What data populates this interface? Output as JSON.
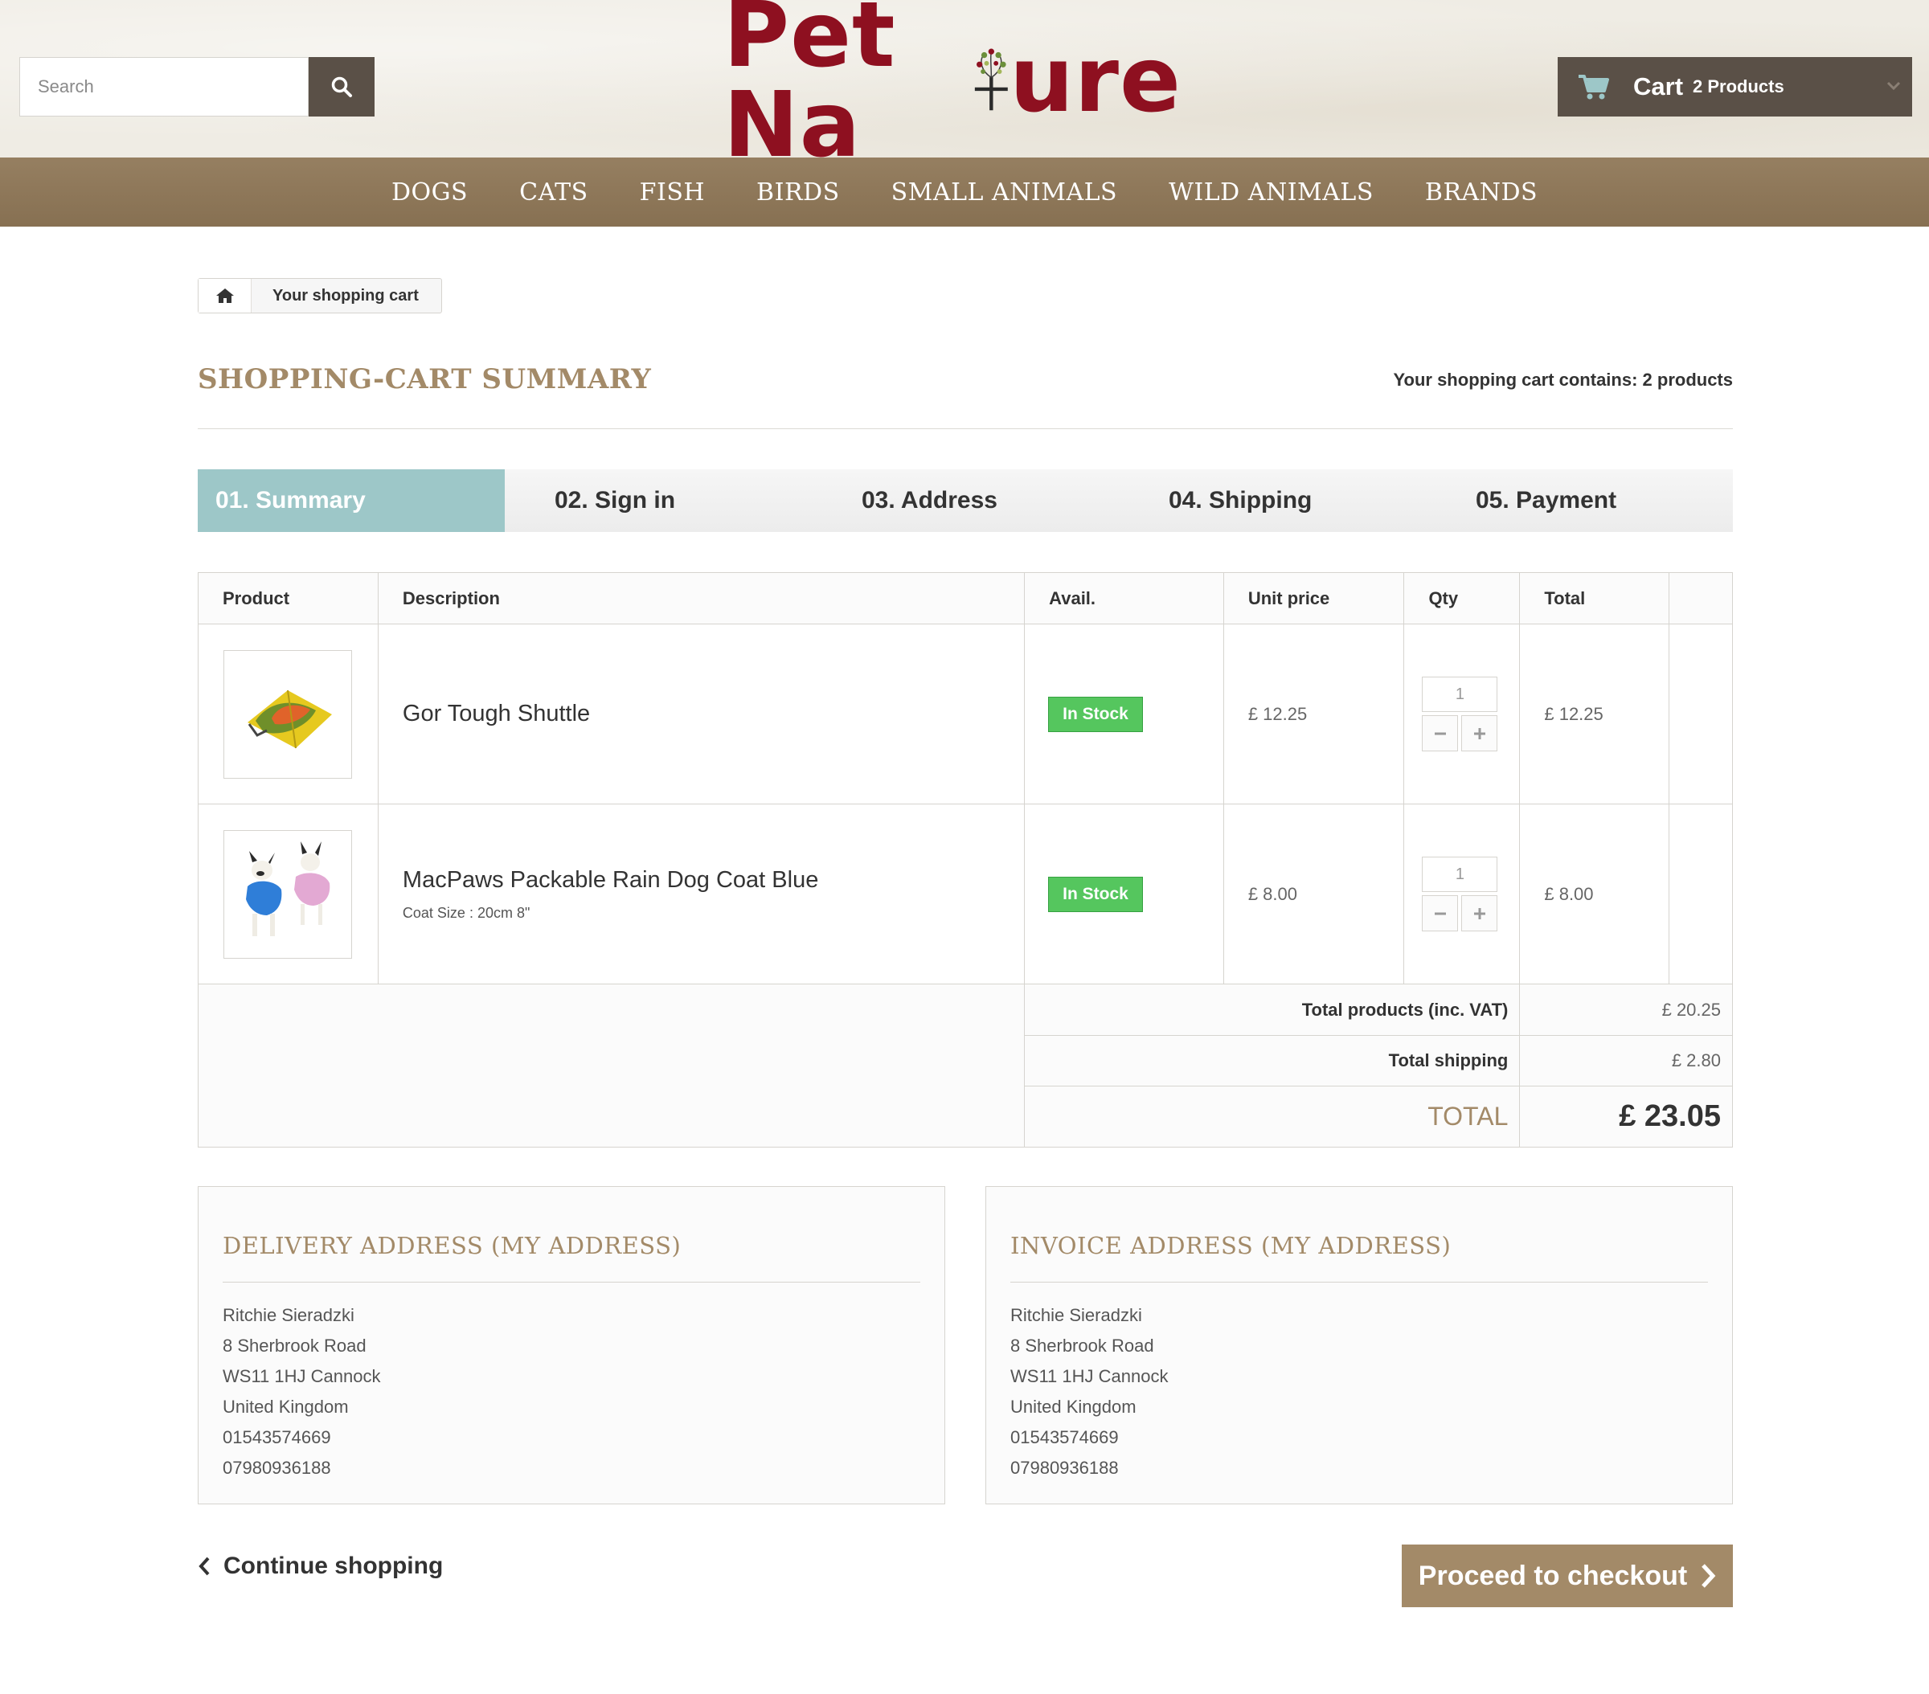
{
  "header": {
    "search_placeholder": "Search",
    "logo_text_left": "Pet Na",
    "logo_text_right": "ure",
    "cart_label": "Cart",
    "cart_count": "2 Products"
  },
  "nav": {
    "items": [
      "DOGS",
      "CATS",
      "FISH",
      "BIRDS",
      "SMALL ANIMALS",
      "WILD ANIMALS",
      "BRANDS"
    ]
  },
  "breadcrumb": {
    "current": "Your shopping cart"
  },
  "page": {
    "title": "SHOPPING-CART SUMMARY",
    "cart_contains": "Your shopping cart contains: 2 products"
  },
  "steps": [
    "01. Summary",
    "02. Sign in",
    "03. Address",
    "04. Shipping",
    "05. Payment"
  ],
  "active_step": 0,
  "table": {
    "headers": [
      "Product",
      "Description",
      "Avail.",
      "Unit price",
      "Qty",
      "Total"
    ],
    "rows": [
      {
        "name": "Gor Tough Shuttle",
        "attribute": "",
        "availability": "In Stock",
        "unit_price": "£ 12.25",
        "qty": "1",
        "total": "£ 12.25"
      },
      {
        "name": "MacPaws Packable Rain Dog Coat Blue",
        "attribute": "Coat Size : 20cm 8\"",
        "availability": "In Stock",
        "unit_price": "£ 8.00",
        "qty": "1",
        "total": "£ 8.00"
      }
    ],
    "totals": {
      "products_label": "Total products (inc. VAT)",
      "products_value": "£ 20.25",
      "shipping_label": "Total shipping",
      "shipping_value": "£ 2.80",
      "total_label": "TOTAL",
      "total_value": "£ 23.05"
    }
  },
  "delivery": {
    "title": "DELIVERY ADDRESS (MY ADDRESS)",
    "lines": [
      "Ritchie Sieradzki",
      "8 Sherbrook Road",
      "WS11 1HJ Cannock",
      "United Kingdom",
      "01543574669",
      "07980936188"
    ]
  },
  "invoice": {
    "title": "INVOICE ADDRESS (MY ADDRESS)",
    "lines": [
      "Ritchie Sieradzki",
      "8 Sherbrook Road",
      "WS11 1HJ Cannock",
      "United Kingdom",
      "01543574669",
      "07980936188"
    ]
  },
  "actions": {
    "continue": "Continue shopping",
    "checkout": "Proceed to checkout"
  },
  "colors": {
    "brand": "#8e1020",
    "dark": "#5a5047",
    "nav": "#8f7757",
    "accent": "#a38a68",
    "active_step": "#9dc7c8",
    "in_stock": "#55c65e"
  },
  "icons": {
    "search": "search-icon",
    "cart": "cart-icon",
    "home": "home-icon",
    "minus": "minus-icon",
    "plus": "plus-icon",
    "chevron_left": "chevron-left-icon",
    "chevron_right": "chevron-right-icon"
  }
}
